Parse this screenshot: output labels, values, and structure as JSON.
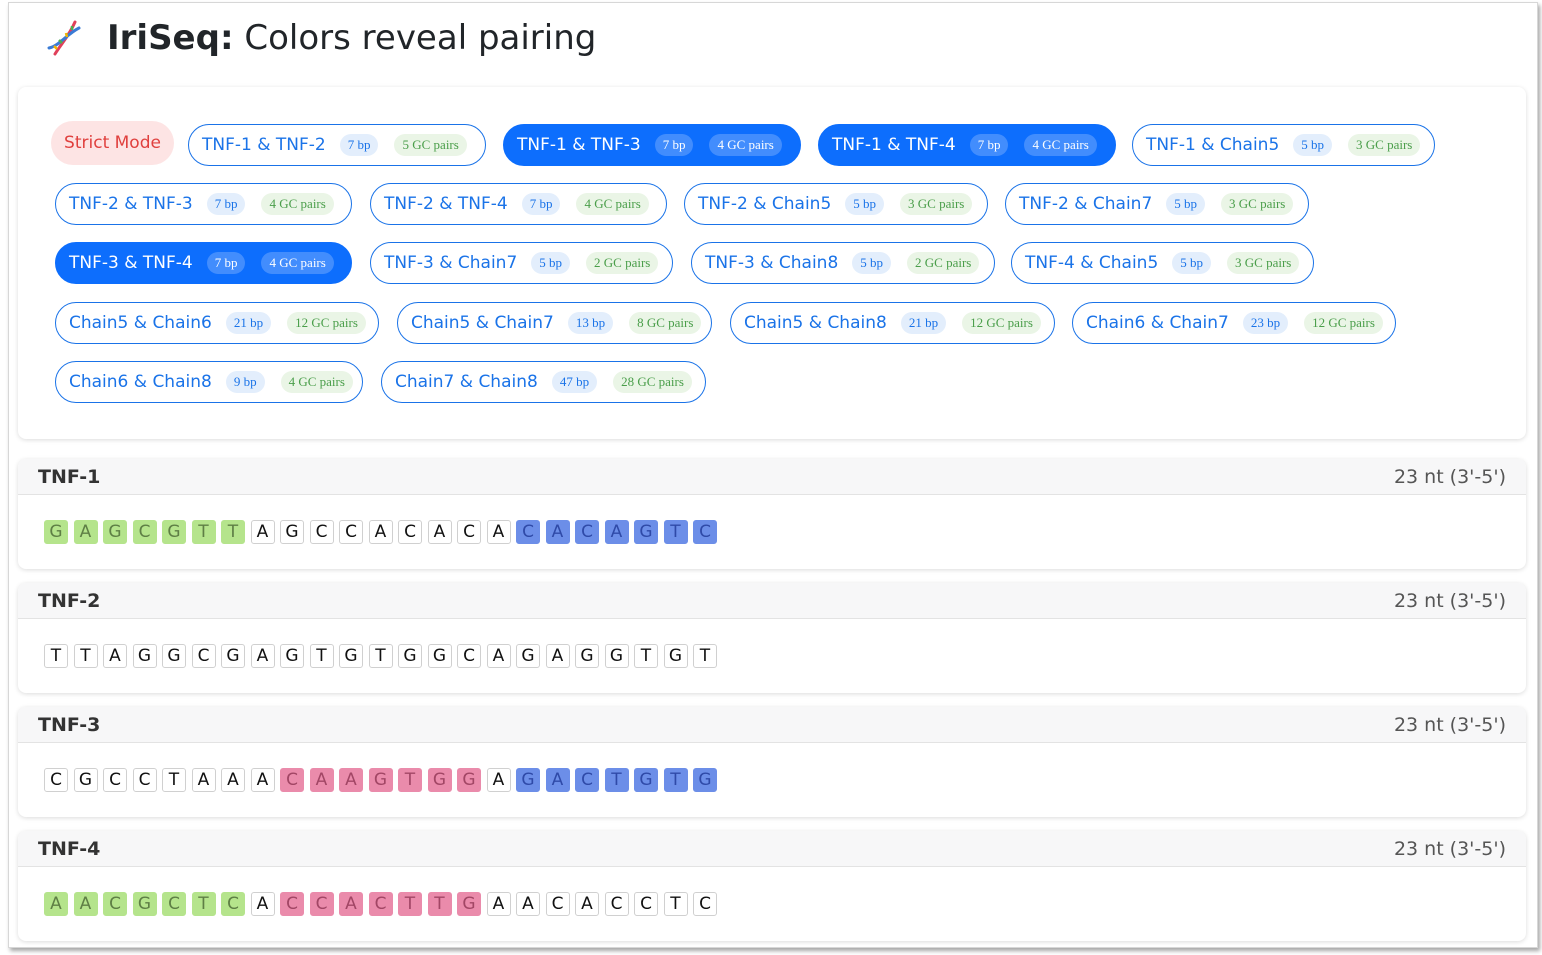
{
  "app": {
    "title_bold": "IriSeq:",
    "title_rest": "Colors reveal pairing"
  },
  "colors": {
    "accent": "#0d6efd",
    "strict": "#e0403e",
    "green": "#b5e48c",
    "blue": "#6c8ee8",
    "pink": "#ea8bab"
  },
  "strict_mode": {
    "label": "Strict Mode"
  },
  "pairs": [
    {
      "label": "TNF-1 & TNF-2",
      "bp": "7 bp",
      "gc": "5 GC pairs",
      "active": false
    },
    {
      "label": "TNF-1 & TNF-3",
      "bp": "7 bp",
      "gc": "4 GC pairs",
      "active": true
    },
    {
      "label": "TNF-1 & TNF-4",
      "bp": "7 bp",
      "gc": "4 GC pairs",
      "active": true
    },
    {
      "label": "TNF-1 & Chain5",
      "bp": "5 bp",
      "gc": "3 GC pairs",
      "active": false
    },
    {
      "label": "TNF-2 & TNF-3",
      "bp": "7 bp",
      "gc": "4 GC pairs",
      "active": false
    },
    {
      "label": "TNF-2 & TNF-4",
      "bp": "7 bp",
      "gc": "4 GC pairs",
      "active": false
    },
    {
      "label": "TNF-2 & Chain5",
      "bp": "5 bp",
      "gc": "3 GC pairs",
      "active": false
    },
    {
      "label": "TNF-2 & Chain7",
      "bp": "5 bp",
      "gc": "3 GC pairs",
      "active": false
    },
    {
      "label": "TNF-3 & TNF-4",
      "bp": "7 bp",
      "gc": "4 GC pairs",
      "active": true
    },
    {
      "label": "TNF-3 & Chain7",
      "bp": "5 bp",
      "gc": "2 GC pairs",
      "active": false
    },
    {
      "label": "TNF-3 & Chain8",
      "bp": "5 bp",
      "gc": "2 GC pairs",
      "active": false
    },
    {
      "label": "TNF-4 & Chain5",
      "bp": "5 bp",
      "gc": "3 GC pairs",
      "active": false
    },
    {
      "label": "Chain5 & Chain6",
      "bp": "21 bp",
      "gc": "12 GC pairs",
      "active": false
    },
    {
      "label": "Chain5 & Chain7",
      "bp": "13 bp",
      "gc": "8 GC pairs",
      "active": false
    },
    {
      "label": "Chain5 & Chain8",
      "bp": "21 bp",
      "gc": "12 GC pairs",
      "active": false
    },
    {
      "label": "Chain6 & Chain7",
      "bp": "23 bp",
      "gc": "12 GC pairs",
      "active": false
    },
    {
      "label": "Chain6 & Chain8",
      "bp": "9 bp",
      "gc": "4 GC pairs",
      "active": false
    },
    {
      "label": "Chain7 & Chain8",
      "bp": "47 bp",
      "gc": "28 GC pairs",
      "active": false
    }
  ],
  "sequences": [
    {
      "name": "TNF-1",
      "length": "23 nt (3'-5')",
      "bases": [
        "G",
        "A",
        "G",
        "C",
        "G",
        "T",
        "T",
        "A",
        "G",
        "C",
        "C",
        "A",
        "C",
        "A",
        "C",
        "A",
        "C",
        "A",
        "C",
        "A",
        "G",
        "T",
        "C"
      ],
      "colors": [
        "green",
        "green",
        "green",
        "green",
        "green",
        "green",
        "green",
        "",
        "",
        "",
        "",
        "",
        "",
        "",
        "",
        "",
        "blue",
        "blue",
        "blue",
        "blue",
        "blue",
        "blue",
        "blue"
      ]
    },
    {
      "name": "TNF-2",
      "length": "23 nt (3'-5')",
      "bases": [
        "T",
        "T",
        "A",
        "G",
        "G",
        "C",
        "G",
        "A",
        "G",
        "T",
        "G",
        "T",
        "G",
        "G",
        "C",
        "A",
        "G",
        "A",
        "G",
        "G",
        "T",
        "G",
        "T"
      ],
      "colors": [
        "",
        "",
        "",
        "",
        "",
        "",
        "",
        "",
        "",
        "",
        "",
        "",
        "",
        "",
        "",
        "",
        "",
        "",
        "",
        "",
        "",
        "",
        ""
      ]
    },
    {
      "name": "TNF-3",
      "length": "23 nt (3'-5')",
      "bases": [
        "C",
        "G",
        "C",
        "C",
        "T",
        "A",
        "A",
        "A",
        "C",
        "A",
        "A",
        "G",
        "T",
        "G",
        "G",
        "A",
        "G",
        "A",
        "C",
        "T",
        "G",
        "T",
        "G"
      ],
      "colors": [
        "",
        "",
        "",
        "",
        "",
        "",
        "",
        "",
        "pink",
        "pink",
        "pink",
        "pink",
        "pink",
        "pink",
        "pink",
        "",
        "blue",
        "blue",
        "blue",
        "blue",
        "blue",
        "blue",
        "blue"
      ]
    },
    {
      "name": "TNF-4",
      "length": "23 nt (3'-5')",
      "bases": [
        "A",
        "A",
        "C",
        "G",
        "C",
        "T",
        "C",
        "A",
        "C",
        "C",
        "A",
        "C",
        "T",
        "T",
        "G",
        "A",
        "A",
        "C",
        "A",
        "C",
        "C",
        "T",
        "C"
      ],
      "colors": [
        "green",
        "green",
        "green",
        "green",
        "green",
        "green",
        "green",
        "",
        "pink",
        "pink",
        "pink",
        "pink",
        "pink",
        "pink",
        "pink",
        "",
        "",
        "",
        "",
        "",
        "",
        "",
        ""
      ]
    }
  ]
}
